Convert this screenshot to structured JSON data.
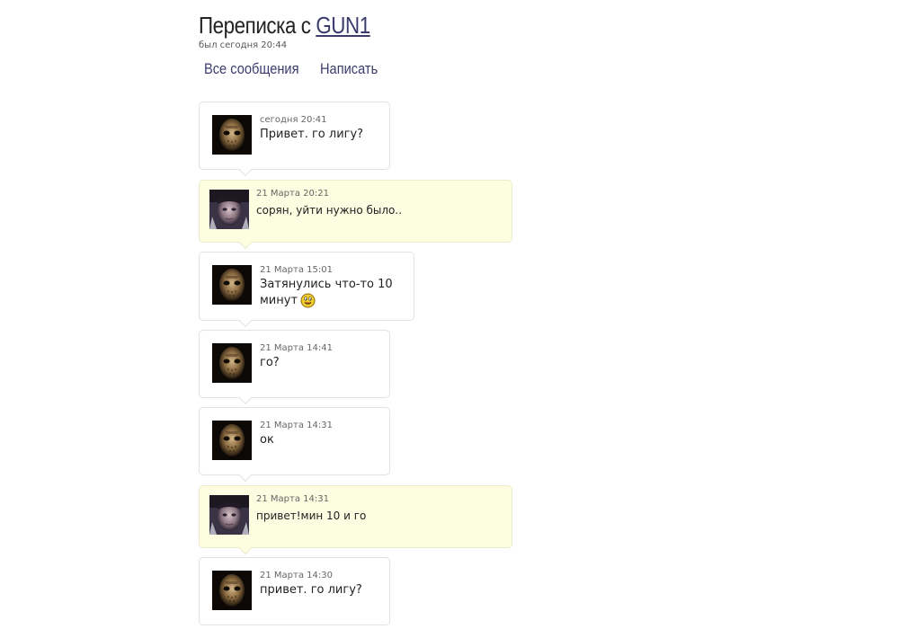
{
  "header": {
    "title_prefix": "Переписка с ",
    "peer_name": "GUN1",
    "last_seen": "был сегодня 20:44"
  },
  "nav": {
    "all_messages": "Все сообщения",
    "write": "Написать"
  },
  "colors": {
    "incoming_bg": "#ffffff",
    "outgoing_bg": "#fdfde2",
    "link": "#3b3b6e"
  },
  "messages": [
    {
      "sender": "peer",
      "avatar": "hockey-mask-avatar",
      "time": "сегодня 20:41",
      "line1": "Привет. го лигу?",
      "line2": ""
    },
    {
      "sender": "me",
      "avatar": "face-avatar",
      "time": "21 Марта 20:21",
      "line1": "сорян, уйти нужно было..",
      "line2": ""
    },
    {
      "sender": "peer",
      "avatar": "hockey-mask-avatar",
      "time": "21 Марта 15:01",
      "line1": "Затянулись что-то 10",
      "line2": "минут",
      "emoji": "smiley-icon"
    },
    {
      "sender": "peer",
      "avatar": "hockey-mask-avatar",
      "time": "21 Марта 14:41",
      "line1": "го?",
      "line2": ""
    },
    {
      "sender": "peer",
      "avatar": "hockey-mask-avatar",
      "time": "21 Марта 14:31",
      "line1": "ок",
      "line2": ""
    },
    {
      "sender": "me",
      "avatar": "face-avatar",
      "time": "21 Марта 14:31",
      "line1": "привет!мин 10 и го",
      "line2": ""
    },
    {
      "sender": "peer",
      "avatar": "hockey-mask-avatar",
      "time": "21 Марта 14:30",
      "line1": "привет. го лигу?",
      "line2": ""
    }
  ]
}
